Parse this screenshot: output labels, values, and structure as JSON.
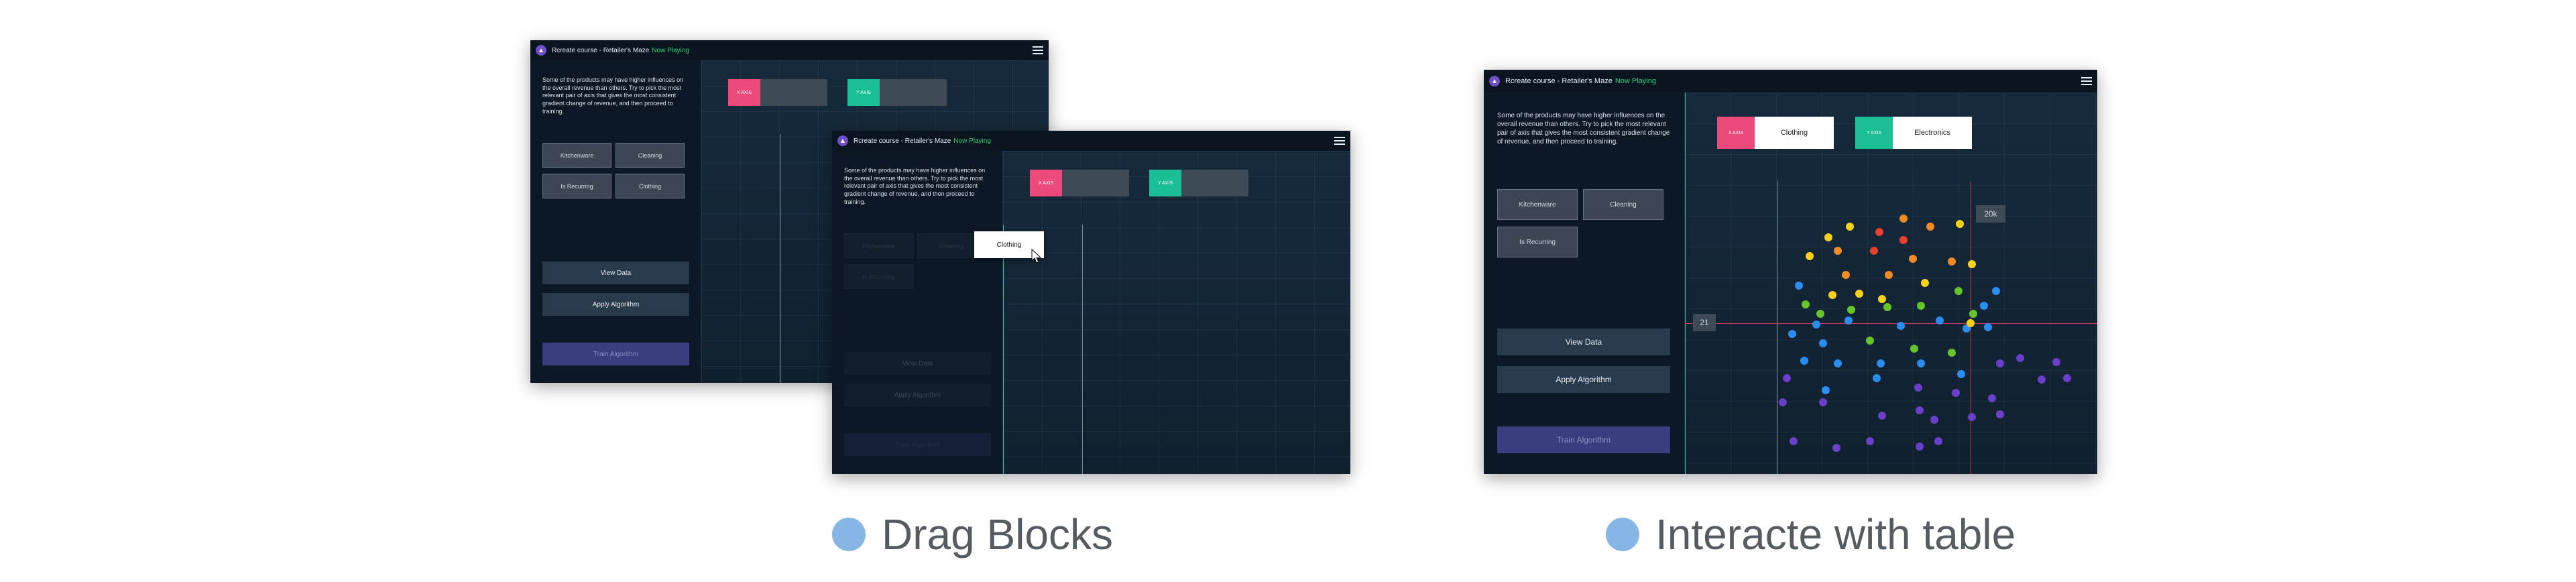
{
  "app": {
    "title": "Rcreate course - Retailer's Maze",
    "status": "Now Playing"
  },
  "intro_text": "Some of the products may have higher influences on the overall revenue than others. Try to pick the most relevant pair of axis that gives the most consistent gradient change of revenue, and then proceed to training.",
  "factors": {
    "kitchenware": "Kitchenware",
    "clothing": "Clothing",
    "cleaning": "Cleaning",
    "is_recurring": "Is Recurring",
    "electronics": "Electronics"
  },
  "axis_tags": {
    "x": "X AXIS",
    "y": "Y AXIS"
  },
  "actions": {
    "view_data": "View Data",
    "apply_algorithm": "Apply Algorithm",
    "train_algorithm": "Train Algorithm"
  },
  "readouts": {
    "x_value": "21",
    "y_value": "20k"
  },
  "captions": {
    "left": "Drag Blocks",
    "right": "Interacte with table"
  },
  "colors": {
    "pink": "#ec4a7a",
    "teal": "#1abf95",
    "caption_dot": "#86b6e4"
  }
}
